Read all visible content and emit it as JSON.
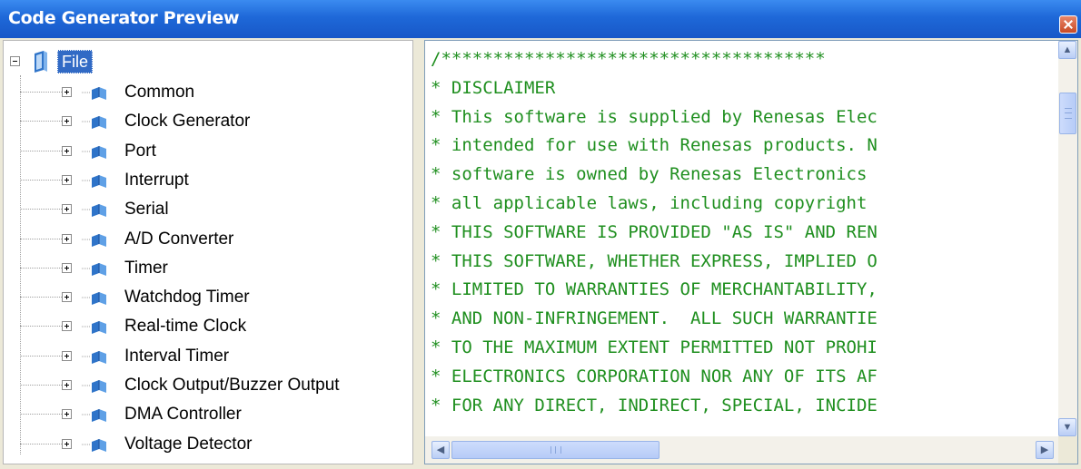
{
  "window": {
    "title": "Code Generator Preview",
    "close_icon": "close-icon"
  },
  "tree": {
    "root": {
      "label": "File",
      "expanded": true,
      "icon": "book-icon"
    },
    "items": [
      {
        "label": "Common"
      },
      {
        "label": "Clock Generator"
      },
      {
        "label": "Port"
      },
      {
        "label": "Interrupt"
      },
      {
        "label": "Serial"
      },
      {
        "label": "A/D Converter"
      },
      {
        "label": "Timer"
      },
      {
        "label": "Watchdog Timer"
      },
      {
        "label": "Real-time Clock"
      },
      {
        "label": "Interval Timer"
      },
      {
        "label": "Clock Output/Buzzer Output"
      },
      {
        "label": "DMA Controller"
      },
      {
        "label": "Voltage Detector"
      }
    ]
  },
  "code": {
    "lines": [
      "/*************************************",
      "* DISCLAIMER",
      "* This software is supplied by Renesas Elec",
      "* intended for use with Renesas products. N",
      "* software is owned by Renesas Electronics",
      "* all applicable laws, including copyright",
      "* THIS SOFTWARE IS PROVIDED \"AS IS\" AND REN",
      "* THIS SOFTWARE, WHETHER EXPRESS, IMPLIED O",
      "* LIMITED TO WARRANTIES OF MERCHANTABILITY,",
      "* AND NON-INFRINGEMENT.  ALL SUCH WARRANTIE",
      "* TO THE MAXIMUM EXTENT PERMITTED NOT PROHI",
      "* ELECTRONICS CORPORATION NOR ANY OF ITS AF",
      "* FOR ANY DIRECT, INDIRECT, SPECIAL, INCIDE"
    ]
  },
  "colors": {
    "title_bar": "#1e68d8",
    "code_text": "#1f8f1f",
    "selection": "#316ac5"
  }
}
